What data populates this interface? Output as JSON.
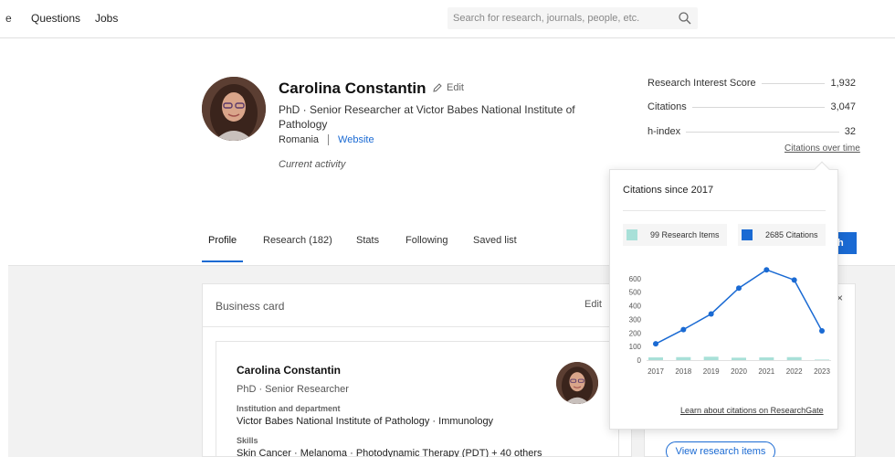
{
  "nav": {
    "cut_label": "e",
    "questions": "Questions",
    "jobs": "Jobs",
    "search_placeholder": "Search for research, journals, people, etc."
  },
  "profile": {
    "name": "Carolina Constantin",
    "edit": "Edit",
    "headline": "PhD · Senior Researcher at Victor Babes National Institute of Pathology",
    "country": "Romania",
    "website": "Website",
    "current_activity": "Current activity"
  },
  "stats": [
    {
      "label": "Research Interest Score",
      "value": "1,932"
    },
    {
      "label": "Citations",
      "value": "3,047"
    },
    {
      "label": "h-index",
      "value": "32"
    }
  ],
  "citations_over_time": "Citations over time",
  "tabs": [
    {
      "label": "Profile",
      "active": true
    },
    {
      "label": "Research (182)"
    },
    {
      "label": "Stats"
    },
    {
      "label": "Following"
    },
    {
      "label": "Saved list"
    }
  ],
  "follow_button_fragment": "h",
  "business_card": {
    "title": "Business card",
    "edit": "Edit",
    "name": "Carolina Constantin",
    "degree": "PhD · Senior Researcher",
    "institution_label": "Institution and department",
    "institution": "Victor Babes National Institute of Pathology · Immunology",
    "skills_label": "Skills",
    "skills": "Skin Cancer · Melanoma · Photodynamic Therapy (PDT) + 40 others"
  },
  "right_card": {
    "close": "×",
    "view_button": "View research items"
  },
  "popup": {
    "title": "Citations since 2017",
    "legend_items": "99 Research Items",
    "legend_citations": "2685 Citations",
    "learn_link": "Learn about citations on ResearchGate"
  },
  "colors": {
    "accent": "#1a6ad3",
    "line": "#1a6ad3",
    "bar": "#a8e0d8"
  },
  "chart_data": {
    "type": "line",
    "x": [
      "2017",
      "2018",
      "2019",
      "2020",
      "2021",
      "2022",
      "2023"
    ],
    "series": [
      {
        "name": "2685 Citations",
        "type": "line",
        "values": [
          120,
          225,
          340,
          530,
          665,
          590,
          215
        ]
      },
      {
        "name": "99 Research Items",
        "type": "bar",
        "values": [
          20,
          22,
          25,
          18,
          20,
          22,
          4
        ]
      }
    ],
    "y_ticks": [
      0,
      100,
      200,
      300,
      400,
      500,
      600
    ],
    "ylim": [
      0,
      700
    ],
    "grid": false
  }
}
